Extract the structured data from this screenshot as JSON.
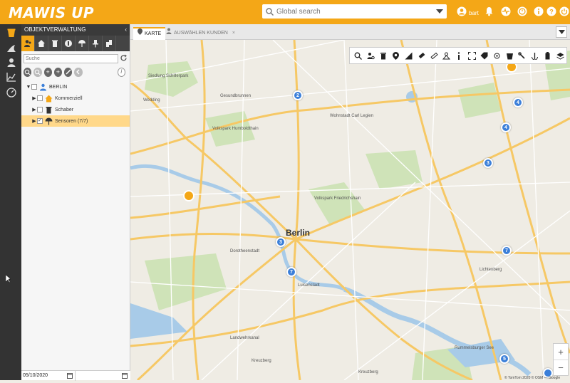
{
  "app": {
    "logo": "MAWIS UP",
    "search_placeholder": "Global search",
    "username": "bart"
  },
  "panel": {
    "title": "OBJEKTVERWALTUNG",
    "filter_placeholder": "Suche",
    "tree": [
      {
        "label": "BERLIN",
        "expand": "▼",
        "checked": false
      },
      {
        "label": "Kommerziell",
        "expand": "▶",
        "checked": false
      },
      {
        "label": "Schaber",
        "expand": "▶",
        "checked": false
      },
      {
        "label": "Sensoren (7/7)",
        "expand": "▶",
        "checked": true,
        "selected": true
      }
    ],
    "date_from": "05/10/2020",
    "date_to": ""
  },
  "tabs": [
    {
      "label": "KARTE",
      "active": true
    },
    {
      "label": "AUSWÄHLEN KUNDEN",
      "active": false
    }
  ],
  "map": {
    "center_label": "Berlin",
    "labels": [
      {
        "text": "Volkspark Humboldthain"
      },
      {
        "text": "Wohnstadt Carl Legien"
      },
      {
        "text": "Volkspark Friedrichshain"
      },
      {
        "text": "Dorotheenstadt"
      },
      {
        "text": "Luisenstadt"
      },
      {
        "text": "Kreuzberg"
      },
      {
        "text": "Landwehrkanal"
      },
      {
        "text": "Kreuzberg"
      },
      {
        "text": "Rummelsburger See"
      },
      {
        "text": "Lichtenberg"
      },
      {
        "text": "Siedlung Schillerpark"
      },
      {
        "text": "Wedding"
      },
      {
        "text": "Gesundbrunnen"
      }
    ],
    "pins": [
      "2",
      "4",
      "4",
      "3",
      "3",
      "7",
      "7",
      "5"
    ],
    "attribution": "© TomTom 2020 © OSM — Google"
  },
  "colors": {
    "brand": "#f4a717",
    "pin": "#3b7fd9",
    "dark": "#333333"
  }
}
